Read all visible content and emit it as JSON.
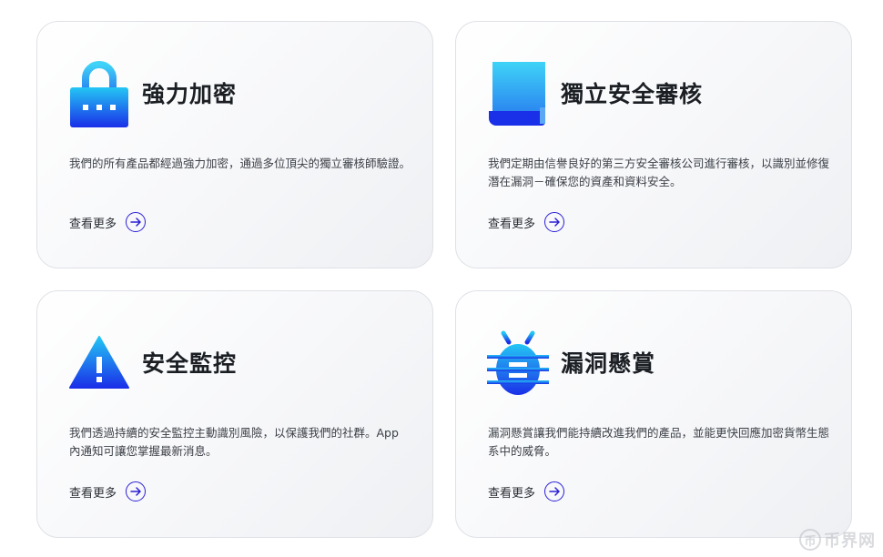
{
  "cards": [
    {
      "icon": "lock-icon",
      "title": "強力加密",
      "description": "我們的所有產品都經過強力加密，通過多位頂尖的獨立審核師驗證。",
      "link_label": "查看更多"
    },
    {
      "icon": "audit-scroll-icon",
      "title": "獨立安全審核",
      "description": "我們定期由信譽良好的第三方安全審核公司進行審核，以識別並修復潛在漏洞－確保您的資產和資料安全。",
      "link_label": "查看更多"
    },
    {
      "icon": "warning-icon",
      "title": "安全監控",
      "description": "我們透過持續的安全監控主動識別風險，以保護我們的社群。App 內通知可讓您掌握最新消息。",
      "link_label": "查看更多"
    },
    {
      "icon": "bug-icon",
      "title": "漏洞懸賞",
      "description": "漏洞懸賞讓我們能持續改進我們的產品，並能更快回應加密貨幣生態系中的威脅。",
      "link_label": "查看更多"
    }
  ],
  "watermark": {
    "glyph": "币",
    "text": "币界网"
  },
  "colors": {
    "accent": "#2b1fd6",
    "icon_top": "#25c8f5",
    "icon_bottom": "#1a2fe8"
  }
}
